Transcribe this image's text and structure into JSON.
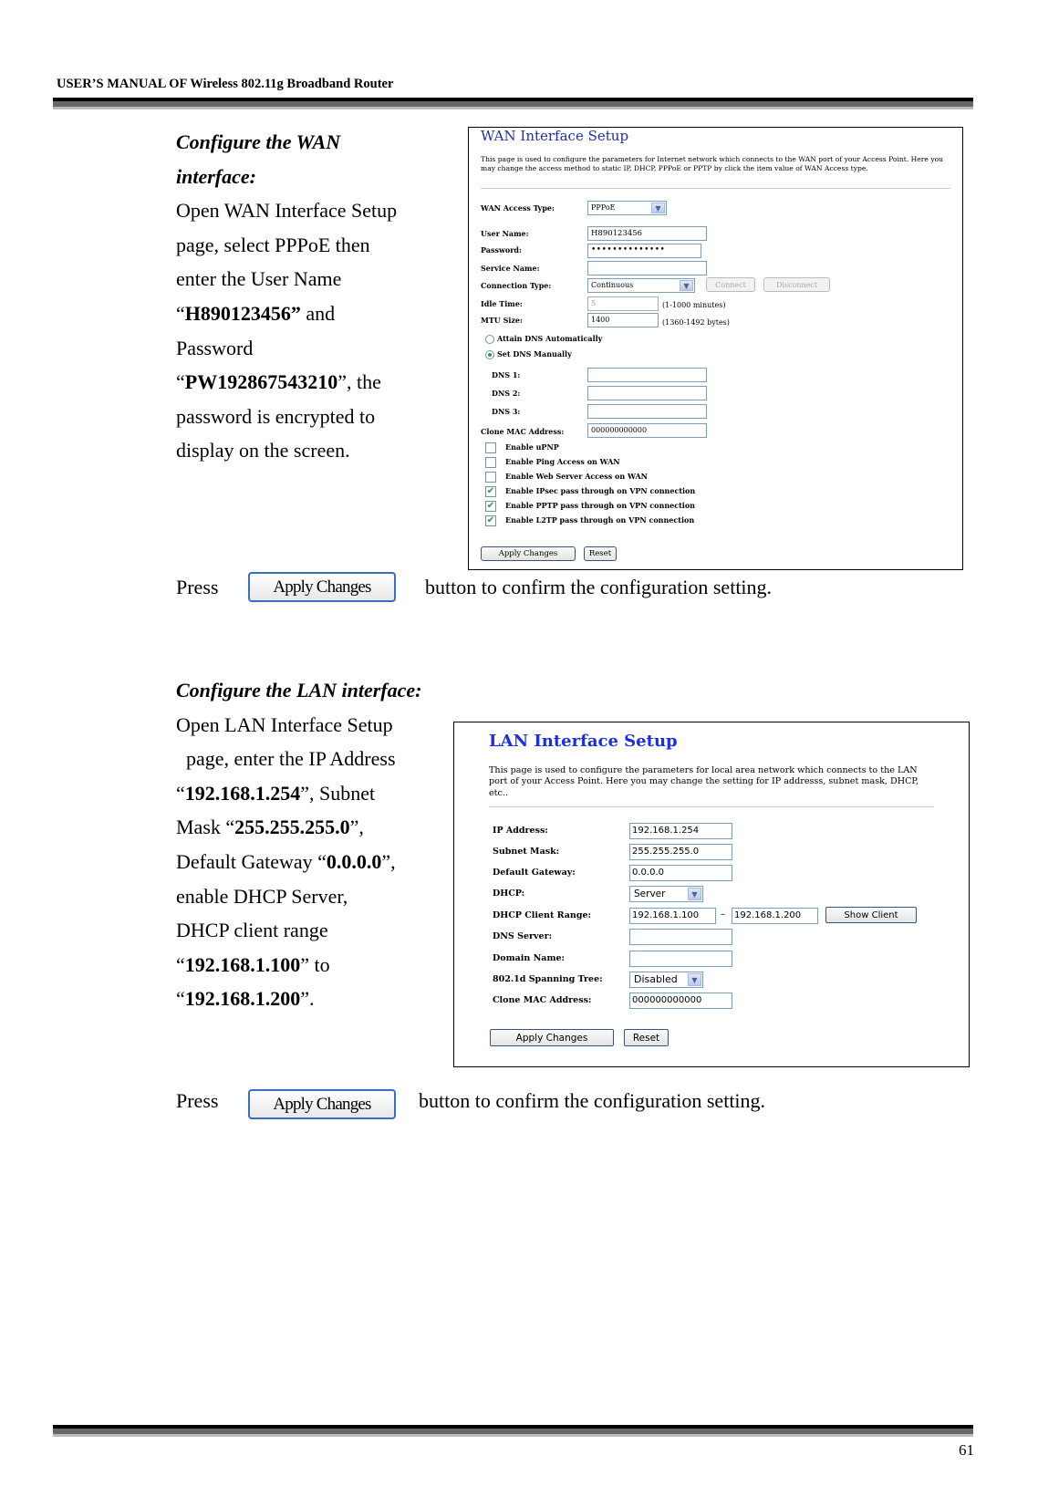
{
  "header": {
    "title": "USER’S MANUAL OF Wireless 802.11g Broadband Router"
  },
  "footer": {
    "page_number": "61"
  },
  "wan_section": {
    "heading_line1": "Configure the WAN",
    "heading_line2": "interface:",
    "lines": [
      {
        "pre": "Open WAN Interface Setup",
        "bold": "",
        "post": ""
      },
      {
        "pre": "page, select PPPoE then",
        "bold": "",
        "post": ""
      },
      {
        "pre": "enter the User Name",
        "bold": "",
        "post": ""
      },
      {
        "pre": "“",
        "bold": "H890123456”",
        "post": " and"
      },
      {
        "pre": "Password",
        "bold": "",
        "post": ""
      },
      {
        "pre": "“",
        "bold": "PW192867543210",
        "post": "”, the"
      },
      {
        "pre": "password is encrypted to",
        "bold": "",
        "post": ""
      },
      {
        "pre": "display on the screen.",
        "bold": "",
        "post": ""
      }
    ],
    "press_label": "Press",
    "press_button": "Apply Changes",
    "press_suffix": "button to confirm the configuration setting."
  },
  "wan_panel": {
    "title": "WAN Interface Setup",
    "description": "This page is used to configure the parameters for Internet network which connects to the WAN port of your Access Point. Here you may change the access method to static IP, DHCP, PPPoE or PPTP by click the item value of WAN Access type.",
    "access_type_label": "WAN Access Type:",
    "access_type_value": "PPPoE",
    "user_name_label": "User Name:",
    "user_name_value": "H890123456",
    "password_label": "Password:",
    "password_value": "••••••••••••••",
    "service_name_label": "Service Name:",
    "service_name_value": "",
    "connection_type_label": "Connection Type:",
    "connection_type_value": "Continuous",
    "connect_button": "Connect",
    "disconnect_button": "Disconnect",
    "idle_time_label": "Idle Time:",
    "idle_time_value": "5",
    "idle_time_hint": "(1-1000 minutes)",
    "mtu_label": "MTU Size:",
    "mtu_value": "1400",
    "mtu_hint": "(1360-1492 bytes)",
    "dns_auto_label": "Attain DNS Automatically",
    "dns_manual_label": "Set DNS Manually",
    "dns1_label": "DNS 1:",
    "dns2_label": "DNS 2:",
    "dns3_label": "DNS 3:",
    "dns1_value": "",
    "dns2_value": "",
    "dns3_value": "",
    "clone_mac_label": "Clone MAC Address:",
    "clone_mac_value": "000000000000",
    "checkboxes": [
      {
        "label": "Enable uPNP",
        "checked": false
      },
      {
        "label": "Enable Ping Access on WAN",
        "checked": false
      },
      {
        "label": "Enable Web Server Access on WAN",
        "checked": false
      },
      {
        "label": "Enable IPsec pass through on VPN connection",
        "checked": true
      },
      {
        "label": "Enable PPTP pass through on VPN connection",
        "checked": true
      },
      {
        "label": "Enable L2TP pass through on VPN connection",
        "checked": true
      }
    ],
    "apply_button": "Apply Changes",
    "reset_button": "Reset"
  },
  "lan_section": {
    "heading": "Configure the LAN interface:",
    "lines": [
      {
        "pre": "Open LAN Interface Setup",
        "bold": "",
        "post": ""
      },
      {
        "pre": "  page, enter the IP Address",
        "bold": "",
        "post": ""
      },
      {
        "pre": "“",
        "bold": "192.168.1.254",
        "post": "”, Subnet"
      },
      {
        "pre": "Mask “",
        "bold": "255.255.255.0",
        "post": "”,"
      },
      {
        "pre": "Default Gateway “",
        "bold": "0.0.0.0",
        "post": "”,"
      },
      {
        "pre": "enable DHCP Server,",
        "bold": "",
        "post": ""
      },
      {
        "pre": "DHCP client range",
        "bold": "",
        "post": ""
      },
      {
        "pre": "“",
        "bold": "192.168.1.100",
        "post": "” to"
      },
      {
        "pre": "“",
        "bold": "192.168.1.200",
        "post": "”."
      }
    ],
    "press_label": "Press",
    "press_button": "Apply Changes",
    "press_suffix": "button to confirm the configuration setting."
  },
  "lan_panel": {
    "title": "LAN Interface Setup",
    "description": "This page is used to configure the parameters for local area network which connects to the LAN port of your Access Point. Here you may change the setting for IP addresss, subnet mask, DHCP, etc..",
    "ip_label": "IP Address:",
    "ip_value": "192.168.1.254",
    "mask_label": "Subnet Mask:",
    "mask_value": "255.255.255.0",
    "gateway_label": "Default Gateway:",
    "gateway_value": "0.0.0.0",
    "dhcp_label": "DHCP:",
    "dhcp_value": "Server",
    "range_label": "DHCP Client Range:",
    "range_start": "192.168.1.100",
    "range_sep": "–",
    "range_end": "192.168.1.200",
    "show_client_button": "Show Client",
    "dns_label": "DNS Server:",
    "dns_value": "",
    "domain_label": "Domain Name:",
    "domain_value": "",
    "stp_label": "802.1d Spanning Tree:",
    "stp_value": "Disabled",
    "clone_mac_label": "Clone MAC Address:",
    "clone_mac_value": "000000000000",
    "apply_button": "Apply Changes",
    "reset_button": "Reset"
  }
}
